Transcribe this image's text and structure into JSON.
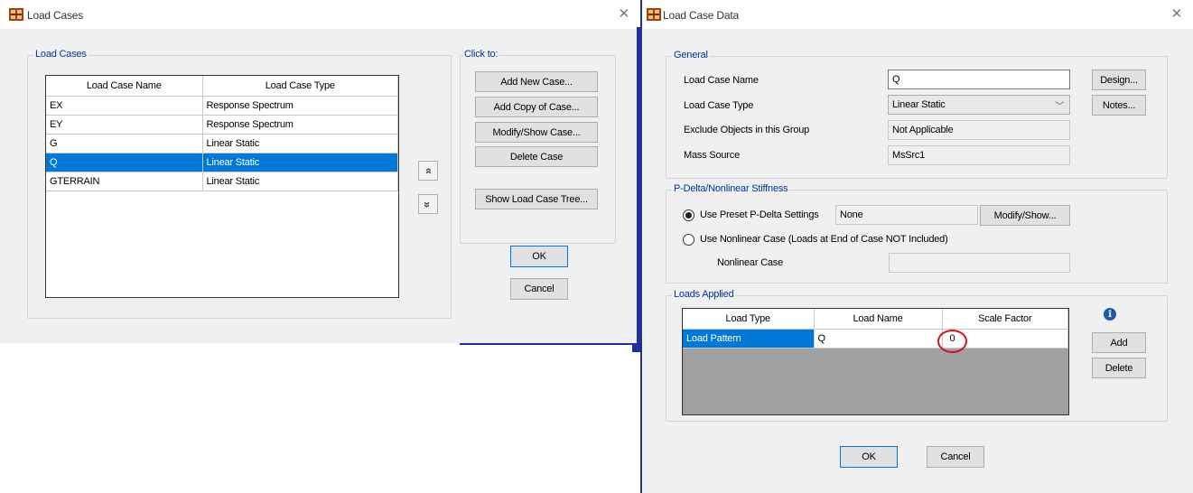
{
  "load_cases_window": {
    "title": "Load Cases",
    "group_title": "Load Cases",
    "columns": [
      "Load Case Name",
      "Load Case Type"
    ],
    "rows": [
      {
        "name": "EX",
        "type": "Response Spectrum"
      },
      {
        "name": "EY",
        "type": "Response Spectrum"
      },
      {
        "name": "G",
        "type": "Linear Static"
      },
      {
        "name": "Q",
        "type": "Linear Static"
      },
      {
        "name": "GTERRAIN",
        "type": "Linear Static"
      }
    ],
    "selected_row": "Q",
    "move_up_glyph": "»",
    "move_down_glyph": "»",
    "click_to": {
      "title": "Click to:",
      "add_new": "Add New Case...",
      "add_copy": "Add Copy of Case...",
      "modify_show": "Modify/Show Case...",
      "delete": "Delete Case",
      "show_tree": "Show Load Case Tree..."
    },
    "ok": "OK",
    "cancel": "Cancel"
  },
  "load_case_data_window": {
    "title": "Load Case Data",
    "general": {
      "title": "General",
      "name_label": "Load Case Name",
      "name_value": "Q",
      "type_label": "Load Case Type",
      "type_value": "Linear Static",
      "exclude_label": "Exclude Objects in this Group",
      "exclude_value": "Not Applicable",
      "mass_label": "Mass Source",
      "mass_value": "MsSrc1",
      "design_button": "Design...",
      "notes_button": "Notes..."
    },
    "pdelta": {
      "title": "P-Delta/Nonlinear Stiffness",
      "preset_label": "Use Preset P-Delta Settings",
      "preset_value": "None",
      "modify_button": "Modify/Show...",
      "nonlinear_label": "Use Nonlinear Case  (Loads at End of Case NOT Included)",
      "nonlinear_case_label": "Nonlinear Case",
      "nonlinear_case_value": ""
    },
    "loads_applied": {
      "title": "Loads Applied",
      "columns": [
        "Load Type",
        "Load Name",
        "Scale Factor"
      ],
      "rows": [
        {
          "load_type": "Load Pattern",
          "load_name": "Q",
          "scale_factor": "0"
        }
      ],
      "info_glyph": "i",
      "add_button": "Add",
      "delete_button": "Delete"
    },
    "ok": "OK",
    "cancel": "Cancel"
  },
  "colors": {
    "selection": "#0078d7",
    "group_title": "#0033a0",
    "highlight_circle": "#d0161c",
    "background_line": "#2030a0"
  }
}
